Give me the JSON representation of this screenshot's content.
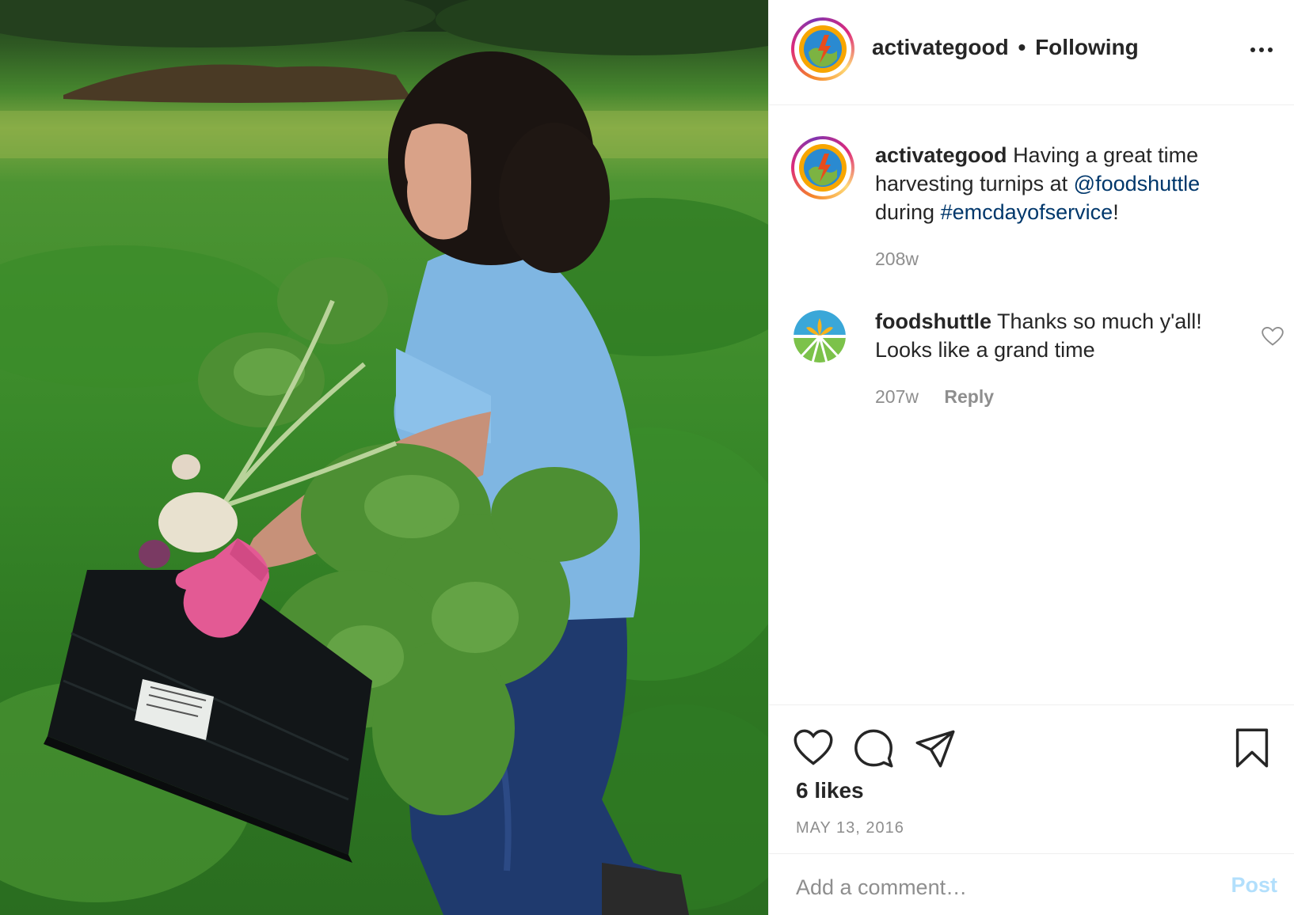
{
  "post_image": {
    "icon": "photo-woman-harvesting-turnips"
  },
  "header": {
    "username": "activategood",
    "separator": "•",
    "follow_status": "Following",
    "avatar_icon": "activategood-logo-icon",
    "more_icon": "more-options-icon"
  },
  "caption": {
    "username": "activategood",
    "text_before": "Having a great time harvesting turnips at",
    "mention": "@foodshuttle",
    "text_middle": "during",
    "hashtag": "#emcdayofservice",
    "text_after": "!",
    "time": "208w"
  },
  "comments": [
    {
      "username": "foodshuttle",
      "text": "Thanks so much y'all! Looks like a grand time",
      "time": "207w",
      "reply_label": "Reply",
      "avatar_icon": "foodshuttle-logo-icon"
    }
  ],
  "actions": {
    "like_icon": "heart-icon",
    "comment_icon": "comment-icon",
    "share_icon": "share-icon",
    "save_icon": "bookmark-icon",
    "likes": "6 likes",
    "date": "MAY 13, 2016"
  },
  "add_comment": {
    "placeholder": "Add a comment…",
    "post_label": "Post"
  },
  "colors": {
    "link": "#00376b",
    "muted": "#8e8e8e",
    "post_disabled": "#b2dffc",
    "text": "#262626"
  }
}
